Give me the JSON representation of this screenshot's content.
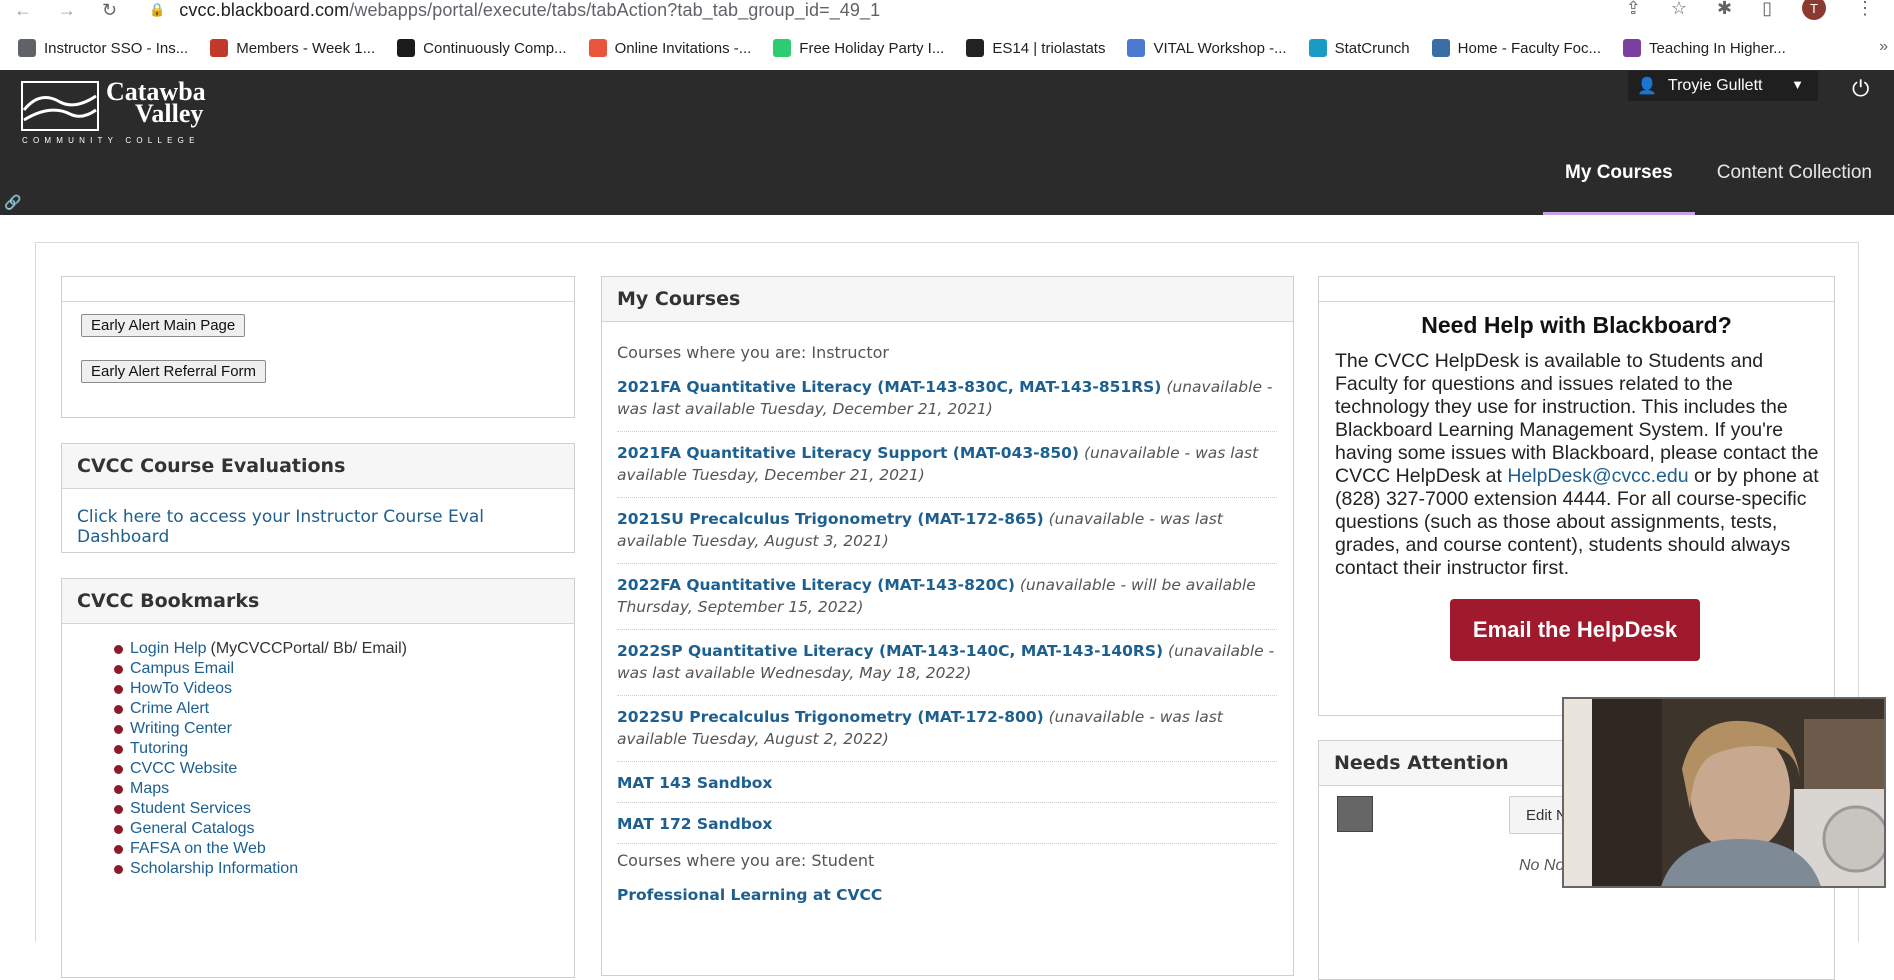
{
  "browser": {
    "url_host": "cvcc.blackboard.com",
    "url_path": "/webapps/portal/execute/tabs/tabAction?tab_tab_group_id=_49_1",
    "profile_initial": "T",
    "bookmarks": [
      {
        "label": "Instructor SSO - Ins...",
        "color": "#5f6368"
      },
      {
        "label": "Members - Week 1...",
        "color": "#c0392b"
      },
      {
        "label": "Continuously Comp...",
        "color": "#1b1b1b"
      },
      {
        "label": "Online Invitations -...",
        "color": "#e8553a"
      },
      {
        "label": "Free Holiday Party I...",
        "color": "#2ecc71"
      },
      {
        "label": "ES14 | triolastats",
        "color": "#222222"
      },
      {
        "label": "VITAL Workshop -...",
        "color": "#4a7bd0"
      },
      {
        "label": "StatCrunch",
        "color": "#1a9bc4"
      },
      {
        "label": "Home - Faculty Foc...",
        "color": "#3a6fa6"
      },
      {
        "label": "Teaching In Higher...",
        "color": "#7b3fa0"
      }
    ],
    "more": "»"
  },
  "header": {
    "logo_line1": "Catawba",
    "logo_line2": "Valley",
    "logo_line3": "COMMUNITY COLLEGE",
    "user_name": "Troyie Gullett",
    "tabs": [
      {
        "label": "My Courses",
        "active": true
      },
      {
        "label": "Content Collection",
        "active": false
      }
    ]
  },
  "left": {
    "early_alert_main": "Early Alert Main Page",
    "early_alert_form": "Early Alert Referral Form",
    "evals_title": "CVCC Course Evaluations",
    "evals_link": "Click here to access your Instructor Course Eval Dashboard",
    "bookmarks_title": "CVCC Bookmarks",
    "bookmarks": [
      {
        "label": "Login Help",
        "extra": "(MyCVCCPortal/ Bb/ Email)"
      },
      {
        "label": "Campus Email",
        "extra": ""
      },
      {
        "label": "HowTo Videos",
        "extra": ""
      },
      {
        "label": "Crime Alert",
        "extra": ""
      },
      {
        "label": "Writing Center",
        "extra": ""
      },
      {
        "label": "Tutoring",
        "extra": ""
      },
      {
        "label": "CVCC Website",
        "extra": ""
      },
      {
        "label": "Maps",
        "extra": ""
      },
      {
        "label": "Student Services",
        "extra": ""
      },
      {
        "label": "General Catalogs",
        "extra": ""
      },
      {
        "label": "FAFSA on the Web",
        "extra": ""
      },
      {
        "label": "Scholarship Information",
        "extra": ""
      }
    ]
  },
  "middle": {
    "title": "My Courses",
    "role_instructor": "Courses where you are: Instructor",
    "courses": [
      {
        "name": "2021FA Quantitative Literacy (MAT-143-830C, MAT-143-851RS)",
        "status": "(unavailable - was last available Tuesday, December 21, 2021)"
      },
      {
        "name": "2021FA Quantitative Literacy Support (MAT-043-850)",
        "status": "(unavailable - was last available Tuesday, December 21, 2021)"
      },
      {
        "name": "2021SU Precalculus Trigonometry (MAT-172-865)",
        "status": "(unavailable - was last available Tuesday, August 3, 2021)"
      },
      {
        "name": "2022FA Quantitative Literacy (MAT-143-820C)",
        "status": "(unavailable - will be available Thursday, September 15, 2022)"
      },
      {
        "name": "2022SP Quantitative Literacy (MAT-143-140C, MAT-143-140RS)",
        "status": "(unavailable - was last available Wednesday, May 18, 2022)"
      },
      {
        "name": "2022SU Precalculus Trigonometry (MAT-172-800)",
        "status": "(unavailable - was last available Tuesday, August 2, 2022)"
      },
      {
        "name": "MAT 143 Sandbox",
        "status": ""
      },
      {
        "name": "MAT 172 Sandbox",
        "status": ""
      }
    ],
    "role_student": "Courses where you are: Student",
    "student_courses": [
      {
        "name": "Professional Learning at CVCC"
      }
    ]
  },
  "right": {
    "help_title": "Need Help with Blackboard?",
    "help_text_1": "The CVCC HelpDesk is available to Students and Faculty for questions and issues related to the technology they use for instruction. This includes the Blackboard Learning Management System. If you're having some issues with Blackboard, please contact the CVCC HelpDesk at",
    "help_email": "HelpDesk@cvcc.edu",
    "help_text_2": "or by phone at (828) 327-7000 extension 4444. For all course-specific questions (such as those about assignments, tests, grades, and course content), students should always contact their instructor first.",
    "email_button": "Email the HelpDesk",
    "needs_title": "Needs Attention",
    "edit_button": "Edit N",
    "no_items": "No No"
  },
  "colors": {
    "header_bg": "#2b2b2b",
    "link": "#1d5f8f",
    "accent_button": "#a0192c",
    "bullet": "#8b1a2b"
  }
}
